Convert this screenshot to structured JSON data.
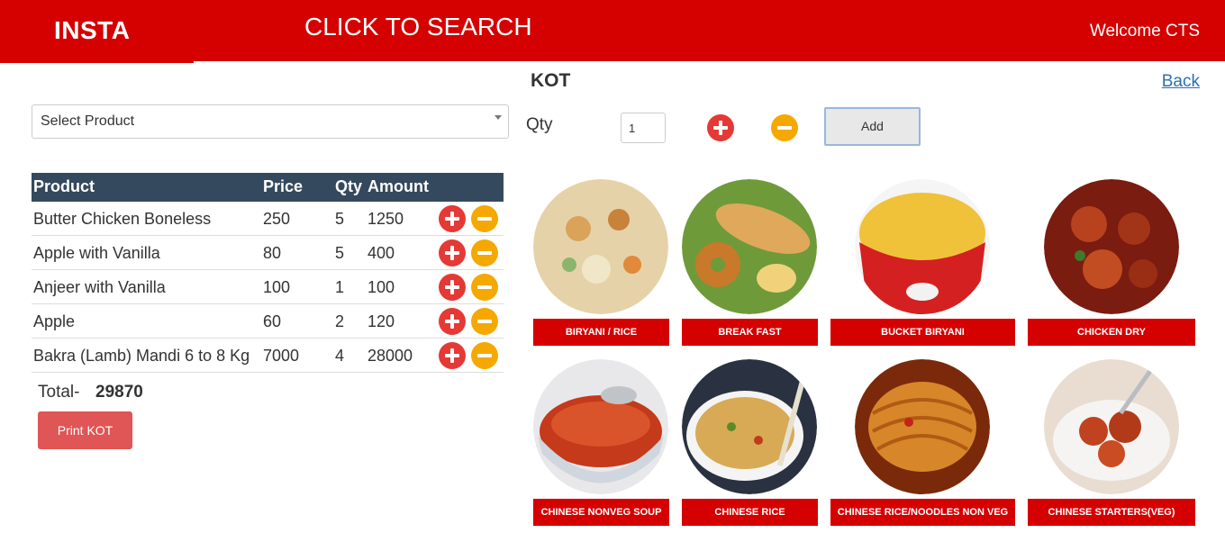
{
  "header": {
    "brand": "INSTA",
    "search_link": "CLICK TO SEARCH",
    "welcome": "Welcome CTS"
  },
  "page": {
    "title": "KOT",
    "back": "Back"
  },
  "product_select": {
    "selected": "Select Product"
  },
  "qty": {
    "label": "Qty",
    "value": "1",
    "add_label": "Add"
  },
  "table": {
    "headers": {
      "product": "Product",
      "price": "Price",
      "qty": "Qty",
      "amount": "Amount"
    },
    "rows": [
      {
        "product": "Butter Chicken Boneless",
        "price": "250",
        "qty": "5",
        "amount": "1250"
      },
      {
        "product": "Apple with Vanilla",
        "price": "80",
        "qty": "5",
        "amount": "400"
      },
      {
        "product": "Anjeer with Vanilla",
        "price": "100",
        "qty": "1",
        "amount": "100"
      },
      {
        "product": "Apple",
        "price": "60",
        "qty": "2",
        "amount": "120"
      },
      {
        "product": "Bakra (Lamb) Mandi 6 to 8 Kg",
        "price": "7000",
        "qty": "4",
        "amount": "28000"
      }
    ]
  },
  "total": {
    "label": "Total-",
    "value": "29870"
  },
  "print_button": "Print KOT",
  "categories": [
    {
      "label": "BIRYANI / RICE"
    },
    {
      "label": "BREAK FAST"
    },
    {
      "label": "BUCKET BIRYANI"
    },
    {
      "label": "CHICKEN DRY"
    },
    {
      "label": "CHINESE NONVEG SOUP"
    },
    {
      "label": "CHINESE RICE"
    },
    {
      "label": "CHINESE RICE/NOODLES NON VEG"
    },
    {
      "label": "CHINESE STARTERS(VEG)"
    }
  ],
  "colors": {
    "brand_red": "#d50000",
    "plus_red": "#e53935",
    "minus_orange": "#f5a800",
    "table_header": "#34495e",
    "print_button": "#e05555",
    "link_blue": "#2a6fb5"
  }
}
